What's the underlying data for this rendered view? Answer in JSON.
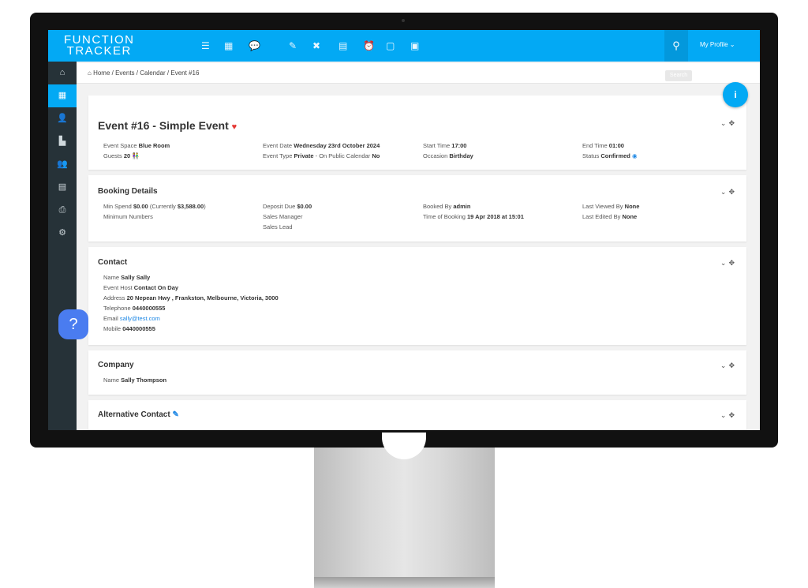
{
  "app": {
    "logo": [
      "FUNCTION",
      "TRACKER"
    ],
    "accent": "#03a9f4",
    "sidebar_color": "#263238"
  },
  "topbar": {
    "icons": [
      "list-icon",
      "calendar-icon",
      "chat-icon",
      "edit-icon",
      "tools-icon",
      "document-icon",
      "alarm-icon",
      "file-icon",
      "folder-icon"
    ],
    "profile_label": "My Profile"
  },
  "sidebar": {
    "items": [
      "home-icon",
      "calendar-icon",
      "user-icon",
      "building-icon",
      "contacts-icon",
      "database-icon",
      "printer-icon",
      "gear-icon"
    ],
    "active": 1
  },
  "breadcrumb": [
    "Home",
    "Events",
    "Calendar",
    "Event #16"
  ],
  "search_label": "Search",
  "event": {
    "title": "Event #16 - Simple Event",
    "fields": [
      {
        "label": "Event Space",
        "value": "Blue Room"
      },
      {
        "label": "Guests",
        "value": "20"
      },
      {
        "label": "Event Date",
        "value": "Wednesday 23rd October 2024"
      },
      {
        "label": "Event Type",
        "value": "Private",
        "extra": "- On Public Calendar",
        "extra_value": "No"
      },
      {
        "label": "Start Time",
        "value": "17:00"
      },
      {
        "label": "Occasion",
        "value": "Birthday"
      },
      {
        "label": "End Time",
        "value": "01:00"
      },
      {
        "label": "Status",
        "value": "Confirmed"
      }
    ]
  },
  "booking": {
    "title": "Booking Details",
    "fields": [
      {
        "label": "Min Spend",
        "value": "$0.00",
        "extra": "(Currently",
        "extra_value": "$3,588.00",
        "close": ")"
      },
      {
        "label": "Minimum Numbers"
      },
      {
        "label": "Deposit Due",
        "value": "$0.00"
      },
      {
        "label": "Sales Manager"
      },
      {
        "label": "Sales Lead"
      },
      {
        "label": "Booked By",
        "value": "admin"
      },
      {
        "label": "Time of Booking",
        "value": "19 Apr 2018 at 15:01"
      },
      {
        "label": "Last Viewed By",
        "value": "None"
      },
      {
        "label": "Last Edited By",
        "value": "None"
      }
    ]
  },
  "contact": {
    "title": "Contact",
    "fields": [
      {
        "label": "Name",
        "value": "Sally Sally"
      },
      {
        "label": "Event Host",
        "value": "Contact On Day"
      },
      {
        "label": "Address",
        "value": "20 Nepean Hwy , Frankston, Melbourne, Victoria, 3000"
      },
      {
        "label": "Telephone",
        "value": "0440000555"
      },
      {
        "label": "Email",
        "value": "sally@test.com"
      },
      {
        "label": "Mobile",
        "value": "0440000555"
      }
    ]
  },
  "company": {
    "title": "Company",
    "fields": [
      {
        "label": "Name",
        "value": "Sally Thompson"
      }
    ]
  },
  "alt_contact": {
    "title": "Alternative Contact"
  }
}
